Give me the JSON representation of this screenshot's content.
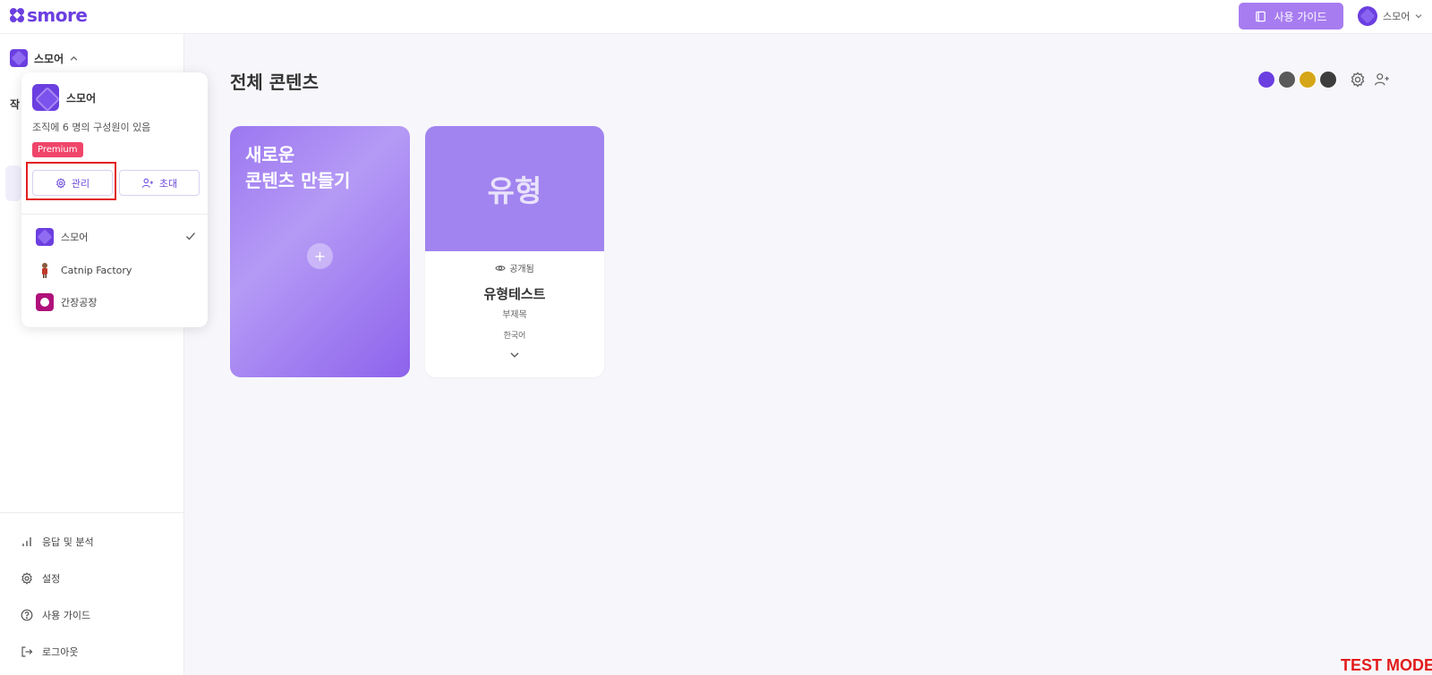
{
  "app": {
    "logo_text": "smore"
  },
  "header": {
    "guide_button": "사용 가이드",
    "user_name": "스모어"
  },
  "sidebar": {
    "org_name": "스모어",
    "hidden_heading": "작",
    "links": [
      {
        "label": "응답 및 분석",
        "icon": "chart-bar-icon"
      },
      {
        "label": "설정",
        "icon": "gear-icon"
      },
      {
        "label": "사용 가이드",
        "icon": "help-circle-icon"
      },
      {
        "label": "로그아웃",
        "icon": "logout-icon"
      }
    ]
  },
  "popover": {
    "org_name": "스모어",
    "description": "조직에 6 명의 구성원이 있음",
    "badge": "Premium",
    "manage_label": "관리",
    "invite_label": "초대",
    "orgs": [
      {
        "name": "스모어",
        "selected": true
      },
      {
        "name": "Catnip Factory",
        "selected": false
      },
      {
        "name": "간장공장",
        "selected": false
      }
    ]
  },
  "main": {
    "title": "전체 콘텐츠",
    "create_card": {
      "title": "새로운\n콘텐츠 만들기"
    },
    "content_card": {
      "thumb_text": "유형",
      "status": "공개됨",
      "title": "유형테스트",
      "subtitle": "부제목",
      "language": "한국어"
    }
  },
  "footer": {
    "mode_label": "TEST MODE"
  },
  "colors": {
    "accent": "#6b3fe0",
    "accent_light": "#a77cf0",
    "premium": "#f0456a",
    "highlight": "#e21c1c"
  }
}
